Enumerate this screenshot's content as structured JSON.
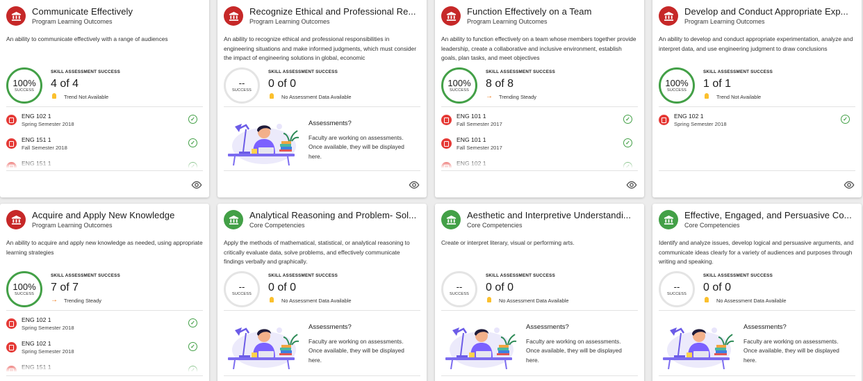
{
  "labels": {
    "skill_success": "SKILL ASSESSMENT SUCCESS",
    "success": "SUCCESS",
    "empty_title": "Assessments?",
    "empty_text": "Faculty are working on assessments. Once available, they will be displayed here."
  },
  "colors": {
    "program": "#c62828",
    "core": "#43a047",
    "ring": "#43a047",
    "trend_steady": "#ef6c00",
    "bulb": "#fbc02d"
  },
  "cards": [
    {
      "title": "Communicate Effectively",
      "category": "Program Learning Outcomes",
      "icon": "institution-icon",
      "description": "An ability to communicate effectively with a range of audiences",
      "percent": "100%",
      "count": "4 of 4",
      "trend_icon": "bulb-icon",
      "trend": "Trend Not Available",
      "courses": [
        {
          "name": "ENG 102 1",
          "semester": "Spring Semester 2018"
        },
        {
          "name": "ENG 151 1",
          "semester": "Fall Semester 2018"
        },
        {
          "name": "ENG 151 1",
          "semester": ""
        }
      ]
    },
    {
      "title": "Recognize Ethical and Professional Re...",
      "category": "Program Learning Outcomes",
      "icon": "institution-icon",
      "description": "An ability to recognize ethical and professional responsibilities in engineering situations and make informed judgments, which must consider the impact of engineering solutions in global, economic",
      "percent": "--",
      "count": "0 of 0",
      "trend_icon": "bulb-icon",
      "trend": "No Assessment Data Available",
      "courses": []
    },
    {
      "title": "Function Effectively on a Team",
      "category": "Program Learning Outcomes",
      "icon": "institution-icon",
      "description": "An ability to function effectively on a team whose members together provide leadership, create a collaborative and inclusive environment, establish goals, plan tasks, and meet objectives",
      "percent": "100%",
      "count": "8 of 8",
      "trend_icon": "arrow-right-icon",
      "trend": "Trending Steady",
      "courses": [
        {
          "name": "ENG 101 1",
          "semester": "Fall Semester 2017"
        },
        {
          "name": "ENG 101 1",
          "semester": "Fall Semester 2017"
        },
        {
          "name": "ENG 102 1",
          "semester": ""
        }
      ]
    },
    {
      "title": "Develop and Conduct Appropriate Exp...",
      "category": "Program Learning Outcomes",
      "icon": "institution-icon",
      "description": "An ability to develop and conduct appropriate experimentation, analyze and interpret data, and use engineering judgment to draw conclusions",
      "percent": "100%",
      "count": "1 of 1",
      "trend_icon": "bulb-icon",
      "trend": "Trend Not Available",
      "courses": [
        {
          "name": "ENG 102 1",
          "semester": "Spring Semester 2018"
        }
      ]
    },
    {
      "title": "Acquire and Apply New Knowledge",
      "category": "Program Learning Outcomes",
      "icon": "institution-icon",
      "description": "An ability to acquire and apply new knowledge as needed, using appropriate learning strategies",
      "percent": "100%",
      "count": "7 of 7",
      "trend_icon": "arrow-right-icon",
      "trend": "Trending Steady",
      "courses": [
        {
          "name": "ENG 102 1",
          "semester": "Spring Semester 2018"
        },
        {
          "name": "ENG 102 1",
          "semester": "Spring Semester 2018"
        },
        {
          "name": "ENG 151 1",
          "semester": ""
        }
      ]
    },
    {
      "title": "Analytical Reasoning and Problem- Sol...",
      "category": "Core Competencies",
      "icon": "institution-icon",
      "description": "Apply the methods of mathematical, statistical, or analytical reasoning to critically evaluate data, solve problems, and effectively communicate findings verbally and graphically.",
      "percent": "--",
      "count": "0 of 0",
      "trend_icon": "bulb-icon",
      "trend": "No Assessment Data Available",
      "courses": []
    },
    {
      "title": "Aesthetic and Interpretive Understandi...",
      "category": "Core Competencies",
      "icon": "institution-icon",
      "description": "Create or interpret literary, visual or performing arts.",
      "percent": "--",
      "count": "0 of 0",
      "trend_icon": "bulb-icon",
      "trend": "No Assessment Data Available",
      "courses": []
    },
    {
      "title": "Effective, Engaged, and Persuasive Co...",
      "category": "Core Competencies",
      "icon": "institution-icon",
      "description": "Identify and analyze issues, develop logical and persuasive arguments, and communicate ideas clearly for a variety of audiences and purposes through writing and speaking.",
      "percent": "--",
      "count": "0 of 0",
      "trend_icon": "bulb-icon",
      "trend": "No Assessment Data Available",
      "courses": []
    }
  ]
}
